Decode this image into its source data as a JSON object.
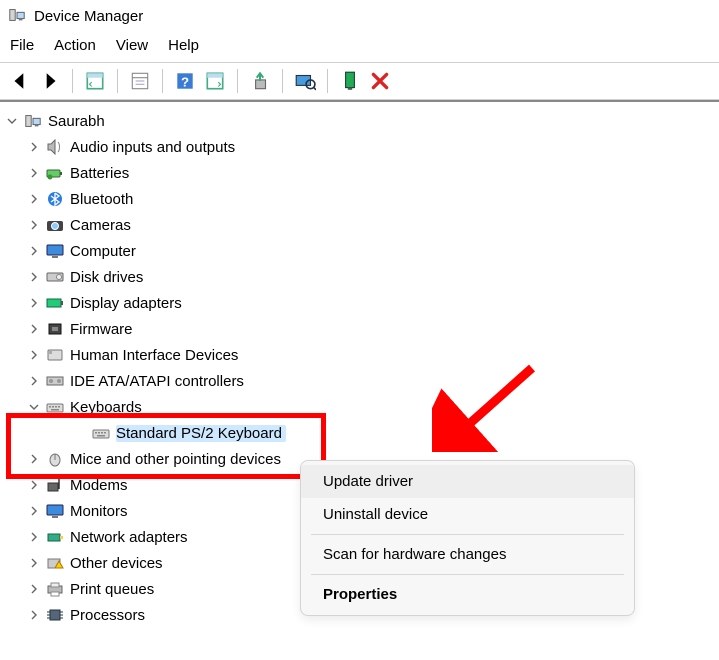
{
  "window": {
    "title": "Device Manager"
  },
  "menu": {
    "file": "File",
    "action": "Action",
    "view": "View",
    "help": "Help"
  },
  "tree": {
    "root": "Saurabh",
    "items": [
      "Audio inputs and outputs",
      "Batteries",
      "Bluetooth",
      "Cameras",
      "Computer",
      "Disk drives",
      "Display adapters",
      "Firmware",
      "Human Interface Devices",
      "IDE ATA/ATAPI controllers",
      "Keyboards",
      "Mice and other pointing devices",
      "Modems",
      "Monitors",
      "Network adapters",
      "Other devices",
      "Print queues",
      "Processors"
    ],
    "keyboard_child": "Standard PS/2 Keyboard"
  },
  "context_menu": {
    "update": "Update driver",
    "uninstall": "Uninstall device",
    "scan": "Scan for hardware changes",
    "properties": "Properties"
  }
}
